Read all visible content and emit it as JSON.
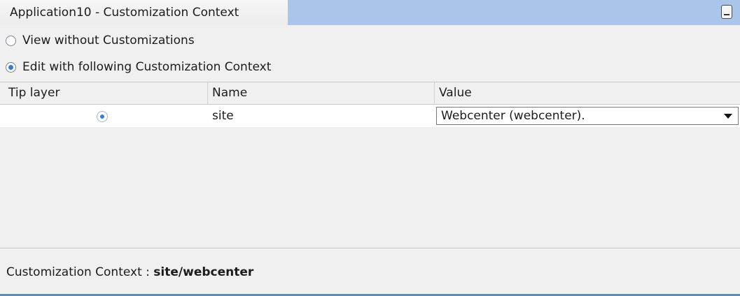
{
  "window": {
    "tab_title": "Application10 - Customization Context",
    "minimize_icon": "minimize-icon"
  },
  "options": {
    "view_without": {
      "label": "View without Customizations",
      "checked": false
    },
    "edit_with": {
      "label": "Edit with following Customization Context",
      "checked": true
    }
  },
  "table": {
    "columns": [
      "Tip layer",
      "Name",
      "Value"
    ],
    "rows": [
      {
        "tip_layer_selected": true,
        "name": "site",
        "value": "Webcenter (webcenter)."
      }
    ]
  },
  "status": {
    "label": "Customization Context : ",
    "value": "site/webcenter"
  },
  "colors": {
    "titlebar": "#a9c6ea",
    "radio_selected": "#3e78c6",
    "bottom_accent": "#5d8dc4"
  }
}
